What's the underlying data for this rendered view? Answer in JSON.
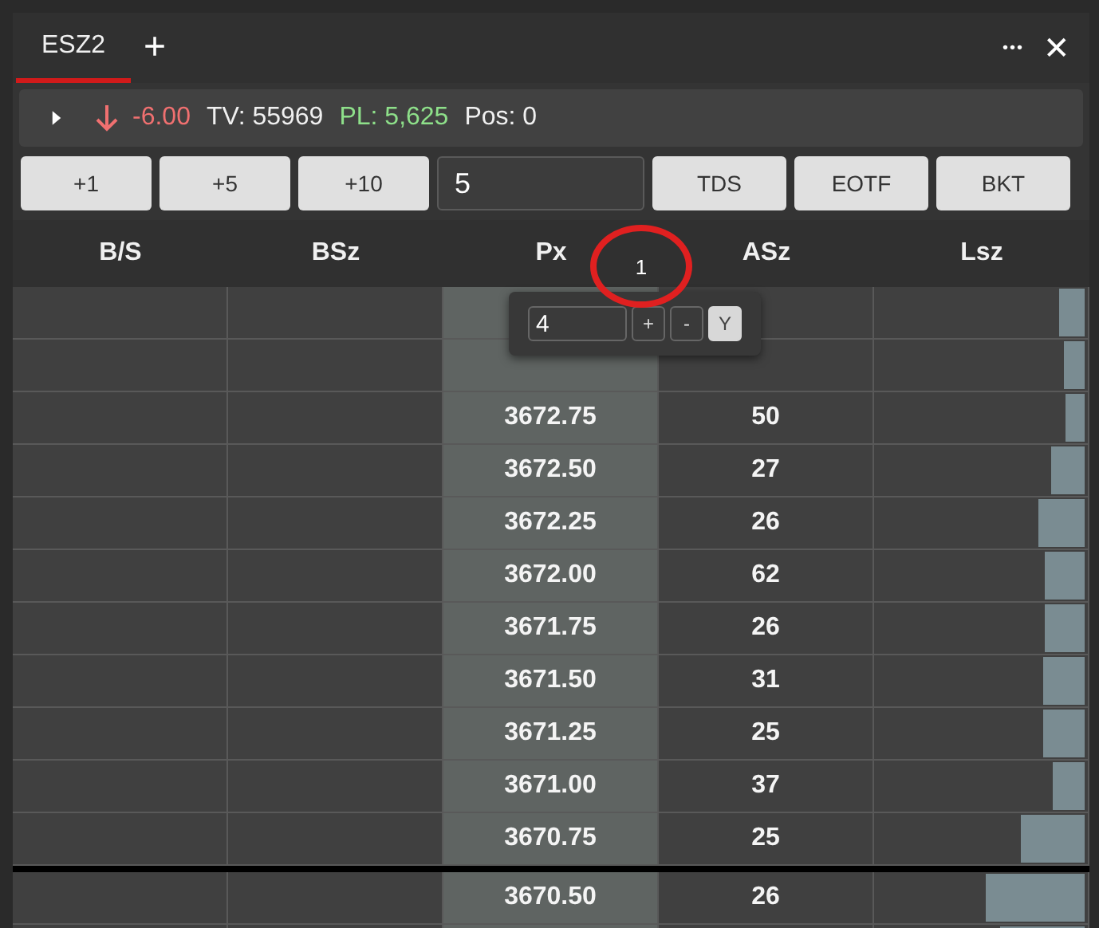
{
  "tabs": [
    {
      "label": "ESZ2",
      "selected": true
    }
  ],
  "tab_actions": {
    "add": "+",
    "more": "•••",
    "close": "✕"
  },
  "info_bar": {
    "expanded": false,
    "falling": true,
    "stats": [
      {
        "text": "-6.00",
        "color": "#f07070"
      },
      {
        "text": "TV: 55969",
        "color": "#f0f0f0"
      },
      {
        "text": "PL: 5,625",
        "color": "#8ee08a"
      },
      {
        "text": "Pos: 0",
        "color": "#f0f0f0"
      }
    ]
  },
  "toolbar": {
    "buttons_left": [
      "+1",
      "+5",
      "+10"
    ],
    "quantity": "5",
    "buttons_right": [
      "TDS",
      "EOTF",
      "BKT"
    ]
  },
  "table": {
    "columns": [
      "B/S",
      "BSz",
      "Px",
      "ASz",
      "Lsz"
    ],
    "rows_above": [
      {
        "level": 0.12
      },
      {
        "level": 0.1
      },
      {
        "px": "3672.75",
        "asz": "50",
        "level": 0.09
      },
      {
        "px": "3672.50",
        "asz": "27",
        "level": 0.16
      },
      {
        "px": "3672.25",
        "asz": "26",
        "level": 0.22
      },
      {
        "px": "3672.00",
        "asz": "62",
        "level": 0.19
      },
      {
        "px": "3671.75",
        "asz": "26",
        "level": 0.19
      },
      {
        "px": "3671.50",
        "asz": "31",
        "level": 0.2
      },
      {
        "px": "3671.25",
        "asz": "25",
        "level": 0.2
      },
      {
        "px": "3671.00",
        "asz": "37",
        "level": 0.15
      },
      {
        "px": "3670.75",
        "asz": "25",
        "level": 0.3
      }
    ],
    "rows_below": [
      {
        "px": "3670.50",
        "asz": "26",
        "level": 0.47
      },
      {
        "level": 0.4
      }
    ]
  },
  "popup": {
    "value": "4",
    "buttons": [
      "+",
      "-",
      "Y"
    ]
  },
  "annotation": {
    "text": "1"
  }
}
